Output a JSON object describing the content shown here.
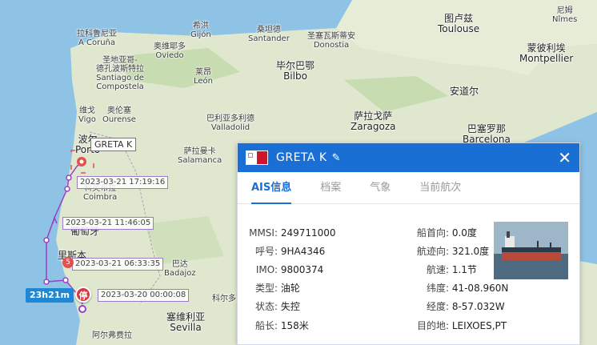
{
  "map": {
    "cities": [
      {
        "key": "c1",
        "lines": [
          "拉科鲁尼亚",
          "A Coruña"
        ],
        "big": false
      },
      {
        "key": "c2",
        "lines": [
          "希洪",
          "Gijón"
        ],
        "big": false
      },
      {
        "key": "c3",
        "lines": [
          "奥维耶多",
          "Oviedo"
        ],
        "big": false
      },
      {
        "key": "c4",
        "lines": [
          "桑坦德",
          "Santander"
        ],
        "big": false
      },
      {
        "key": "c5",
        "lines": [
          "圣塞瓦斯蒂安",
          "Donostia"
        ],
        "big": false
      },
      {
        "key": "c6",
        "lines": [
          "图卢兹",
          "Toulouse"
        ],
        "big": true
      },
      {
        "key": "c7",
        "lines": [
          "尼姆",
          "Nîmes"
        ],
        "big": false
      },
      {
        "key": "c8",
        "lines": [
          "蒙彼利埃",
          "Montpellier"
        ],
        "big": true
      },
      {
        "key": "c9",
        "lines": [
          "圣地亚哥-",
          "德孔波斯特拉",
          "Santiago de",
          "Compostela"
        ],
        "big": false
      },
      {
        "key": "c10",
        "lines": [
          "莱昂",
          "León"
        ],
        "big": false
      },
      {
        "key": "c11",
        "lines": [
          "毕尔巴鄂",
          "Bilbo"
        ],
        "big": true
      },
      {
        "key": "c12",
        "lines": [
          "安道尔"
        ],
        "big": true
      },
      {
        "key": "c13",
        "lines": [
          "维戈",
          "Vigo"
        ],
        "big": false
      },
      {
        "key": "c14",
        "lines": [
          "奥伦塞",
          "Ourense"
        ],
        "big": false
      },
      {
        "key": "c15",
        "lines": [
          "巴利亚多利德",
          "Valladolid"
        ],
        "big": false
      },
      {
        "key": "c16",
        "lines": [
          "萨拉戈萨",
          "Zaragoza"
        ],
        "big": true
      },
      {
        "key": "c17",
        "lines": [
          "巴塞罗那",
          "Barcelona"
        ],
        "big": true
      },
      {
        "key": "c18",
        "lines": [
          "波尔",
          "Porto"
        ],
        "big": true
      },
      {
        "key": "c19",
        "lines": [
          "萨拉曼卡",
          "Salamanca"
        ],
        "big": false
      },
      {
        "key": "c20",
        "lines": [
          "科英布拉",
          "Coimbra"
        ],
        "big": false
      },
      {
        "key": "c21",
        "lines": [
          "葡萄牙"
        ],
        "big": true
      },
      {
        "key": "c22",
        "lines": [
          "里斯本"
        ],
        "big": true
      },
      {
        "key": "c23",
        "lines": [
          "巴达",
          "Badajoz"
        ],
        "big": false
      },
      {
        "key": "c24",
        "lines": [
          "科尔多瓦"
        ],
        "big": false
      },
      {
        "key": "c25",
        "lines": [
          "塞维利亚",
          "Sevilla"
        ],
        "big": true
      },
      {
        "key": "c26",
        "lines": [
          "阿尔弗费拉"
        ],
        "big": false
      }
    ],
    "ship_label": "GRETA K",
    "track_labels": [
      "2023-03-21 17:19:16",
      "2023-03-21 11:46:05",
      "2023-03-21 06:33:35",
      "2023-03-20 00:00:08"
    ],
    "duration": "23h21m",
    "stop_badge": "停",
    "small_badge": "5"
  },
  "panel": {
    "ship_name": "GRETA K",
    "edit_icon": "✎",
    "close_icon": "✕",
    "tabs": [
      "AIS信息",
      "档案",
      "气象",
      "当前航次"
    ],
    "left": [
      {
        "label": "MMSI:",
        "value": "249711000"
      },
      {
        "label": "呼号:",
        "value": "9HA4346"
      },
      {
        "label": "IMO:",
        "value": "9800374"
      },
      {
        "label": "类型:",
        "value": "油轮"
      },
      {
        "label": "状态:",
        "value": "失控"
      },
      {
        "label": "船长:",
        "value": "158米"
      }
    ],
    "right": [
      {
        "label": "船首向:",
        "value": "0.0度"
      },
      {
        "label": "航迹向:",
        "value": "321.0度"
      },
      {
        "label": "航速:",
        "value": "1.1节"
      },
      {
        "label": "纬度:",
        "value": "41-08.960N"
      },
      {
        "label": "经度:",
        "value": "8-57.032W"
      },
      {
        "label": "目的地:",
        "value": "LEIXOES,PT"
      }
    ]
  },
  "colors": {
    "accent": "#1a6fd4",
    "sea": "#8fc3e6",
    "land": "#dfe8cf",
    "track": "#9b3fc4"
  }
}
